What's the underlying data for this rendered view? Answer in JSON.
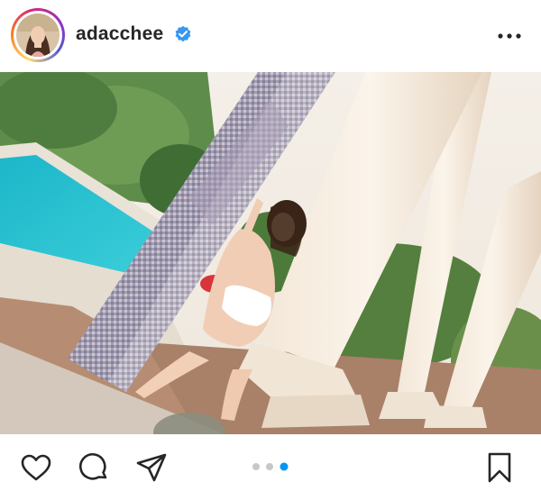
{
  "post": {
    "username": "adacchee",
    "verified": true,
    "carousel": {
      "count": 3,
      "active_index": 2
    }
  },
  "icons": {
    "avatar": "avatar",
    "verified": "verified-badge-icon",
    "more": "more-options-icon",
    "like": "heart-icon",
    "comment": "comment-icon",
    "share": "send-icon",
    "save": "bookmark-icon"
  },
  "colors": {
    "text": "#262626",
    "verified_blue": "#3897f0",
    "dot_active": "#0095f6",
    "dot_inactive": "#c7c7c7"
  }
}
